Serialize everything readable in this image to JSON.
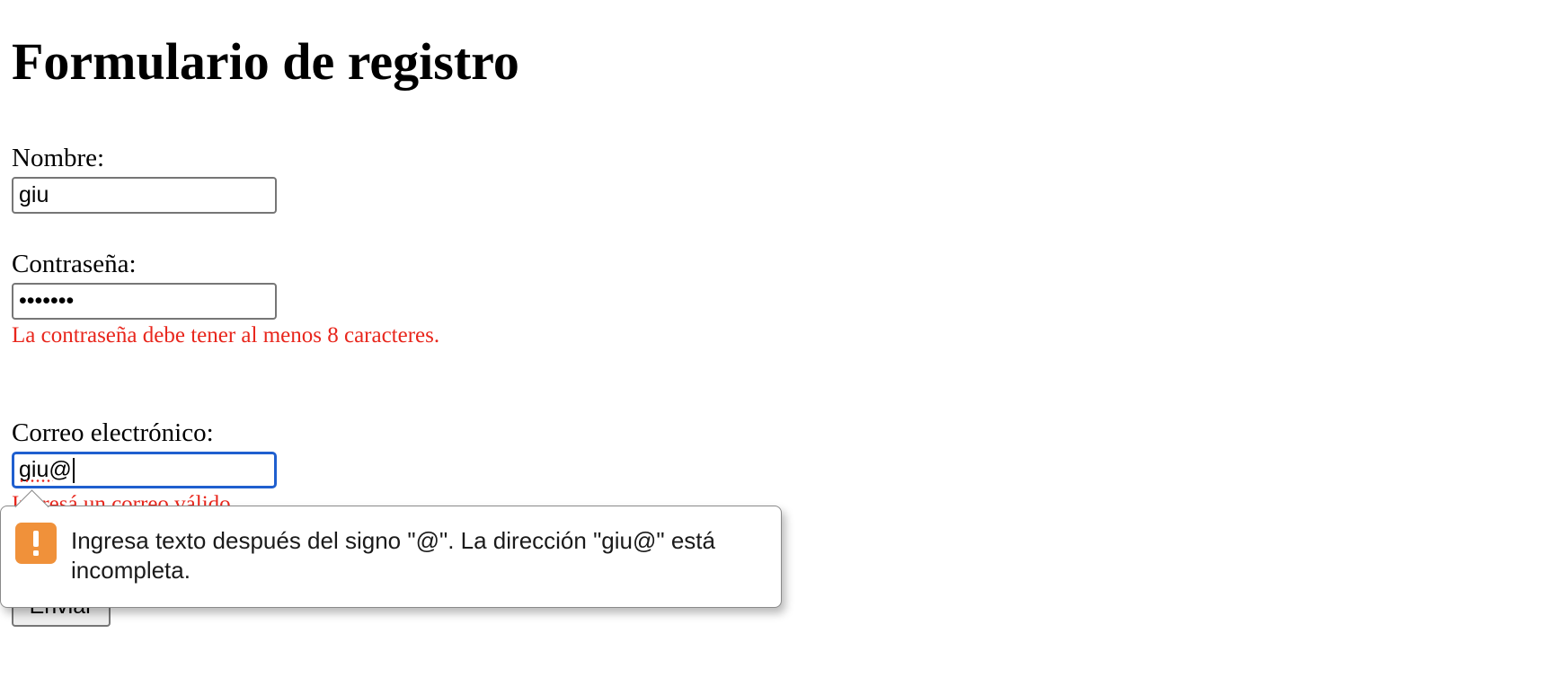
{
  "page": {
    "title": "Formulario de registro"
  },
  "form": {
    "name": {
      "label": "Nombre:",
      "value": "giu"
    },
    "password": {
      "label": "Contraseña:",
      "value": "•••••••",
      "error": "La contraseña debe tener al menos 8 caracteres."
    },
    "email": {
      "label": "Correo electrónico:",
      "value": "giu@",
      "error": "Ingresá un correo válido."
    },
    "submit_label": "Enviar"
  },
  "validation_tooltip": {
    "icon": "warning-icon",
    "message": "Ingresa texto después del signo \"@\". La dirección \"giu@\" está incompleta.",
    "icon_color": "#f0913a"
  },
  "colors": {
    "error": "#e8261c",
    "focus": "#1f5fcf"
  }
}
